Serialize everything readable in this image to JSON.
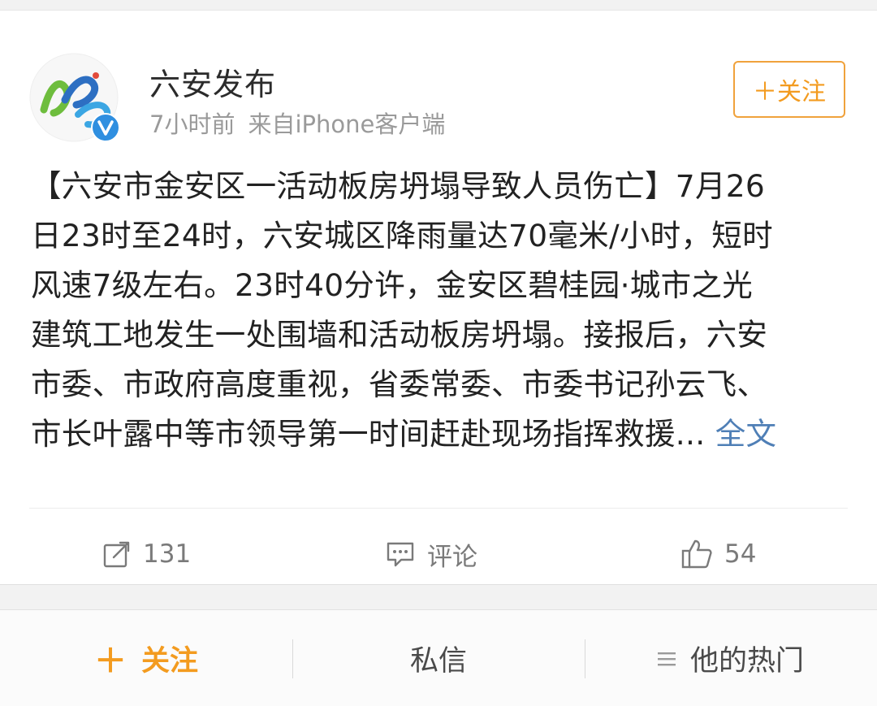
{
  "post": {
    "author": "六安发布",
    "time": "7小时前",
    "source": "来自iPhone客户端",
    "follow_label": "＋关注",
    "text_lines": [
      "【六安市金安区一活动板房坍塌导致人员伤亡】7月26",
      "日23时至24时，六安城区降雨量达70毫米/小时，短时",
      "风速7级左右。23时40分许，金安区碧桂园·城市之光",
      "建筑工地发生一处围墙和活动板房坍塌。接报后，六安",
      "市委、市政府高度重视，省委常委、市委书记孙云飞、",
      "市长叶露中等市领导第一时间赶赴现场指挥救援..."
    ],
    "full_text_link": " 全文"
  },
  "actions": {
    "repost_count": "131",
    "comment_label": "评论",
    "like_count": "54",
    "repost_icon": "repost-icon",
    "comment_icon": "comment-icon",
    "like_icon": "thumbs-up-icon"
  },
  "bottom_bar": {
    "follow_label": "关注",
    "message_label": "私信",
    "hot_label": "他的热门",
    "follow_icon": "plus-icon",
    "hot_icon": "menu-icon"
  },
  "colors": {
    "accent": "#f39b1f",
    "link": "#4f7fb6",
    "verified": "#2f8fe0",
    "muted": "#9a9a9a"
  }
}
